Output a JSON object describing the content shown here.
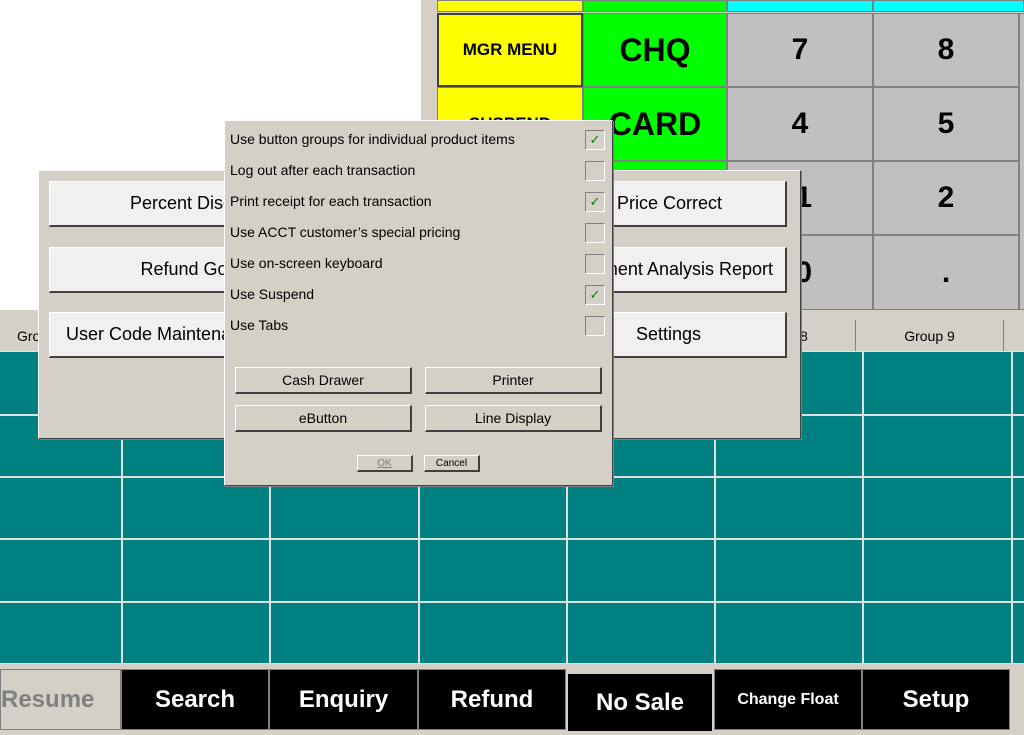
{
  "keypad": {
    "mgr_menu": "MGR MENU",
    "chq": "CHQ",
    "suspend": "SUSPEND",
    "card": "CARD",
    "k7": "7",
    "k8": "8",
    "k4": "4",
    "k5": "5",
    "k1": "1",
    "k2": "2",
    "k0": "0",
    "dot": "."
  },
  "colors": {
    "yellow": "#ffff00",
    "green": "#00ff00",
    "cyan": "#00ffff",
    "key_gray": "#c0c0c0",
    "teal": "#008080"
  },
  "tabs": {
    "left": "Gro",
    "g8": "8",
    "g9": "Group 9"
  },
  "bottom": {
    "resume": "Resume",
    "search": "Search",
    "enquiry": "Enquiry",
    "refund": "Refund",
    "no_sale": "No Sale",
    "change_float": "Change Float",
    "setup": "Setup"
  },
  "mgr_dialog": {
    "percent_discount": "Percent Discount",
    "refund_goods": "Refund Goods",
    "user_code": "User Code Maintenance",
    "price_correct": "Price Correct",
    "analysis": "Department Analysis Report",
    "settings": "Settings"
  },
  "settings_dialog": {
    "options": [
      {
        "label": "Use button groups for individual product items",
        "checked": true
      },
      {
        "label": "Log out after each transaction",
        "checked": false
      },
      {
        "label": "Print receipt for each transaction",
        "checked": true
      },
      {
        "label": "Use ACCT customer’s special pricing",
        "checked": false
      },
      {
        "label": "Use on-screen keyboard",
        "checked": false
      },
      {
        "label": "Use Suspend",
        "checked": true
      },
      {
        "label": "Use Tabs",
        "checked": false
      }
    ],
    "cash_drawer": "Cash Drawer",
    "printer": "Printer",
    "ebutton": "eButton",
    "line_display": "Line Display",
    "ok": "OK",
    "cancel": "Cancel",
    "check_mark": "✓"
  }
}
